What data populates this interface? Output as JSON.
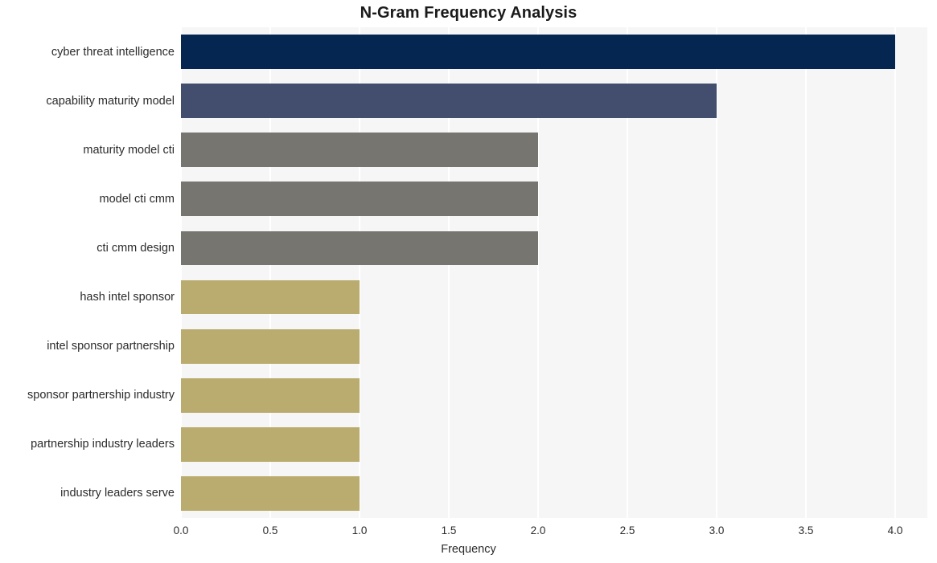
{
  "chart_data": {
    "type": "bar",
    "orientation": "horizontal",
    "title": "N-Gram Frequency Analysis",
    "xlabel": "Frequency",
    "ylabel": "",
    "xlim": [
      0.0,
      4.18
    ],
    "xticks": [
      "0.0",
      "0.5",
      "1.0",
      "1.5",
      "2.0",
      "2.5",
      "3.0",
      "3.5",
      "4.0"
    ],
    "xtick_values": [
      0.0,
      0.5,
      1.0,
      1.5,
      2.0,
      2.5,
      3.0,
      3.5,
      4.0
    ],
    "grid": "vertical-white-on-light-gray",
    "legend": "none",
    "categories": [
      "cyber threat intelligence",
      "capability maturity model",
      "maturity model cti",
      "model cti cmm",
      "cti cmm design",
      "hash intel sponsor",
      "intel sponsor partnership",
      "sponsor partnership industry",
      "partnership industry leaders",
      "industry leaders serve"
    ],
    "values": [
      4,
      3,
      2,
      2,
      2,
      1,
      1,
      1,
      1,
      1
    ],
    "bar_colors": [
      "#042650",
      "#434E6E",
      "#77756F",
      "#77756F",
      "#77756F",
      "#BAAC6F",
      "#BAAC6F",
      "#BAAC6F",
      "#BAAC6F",
      "#BAAC6F"
    ],
    "plot_bgcolor": "#f6f6f7",
    "figure_bgcolor": "#ffffff"
  }
}
